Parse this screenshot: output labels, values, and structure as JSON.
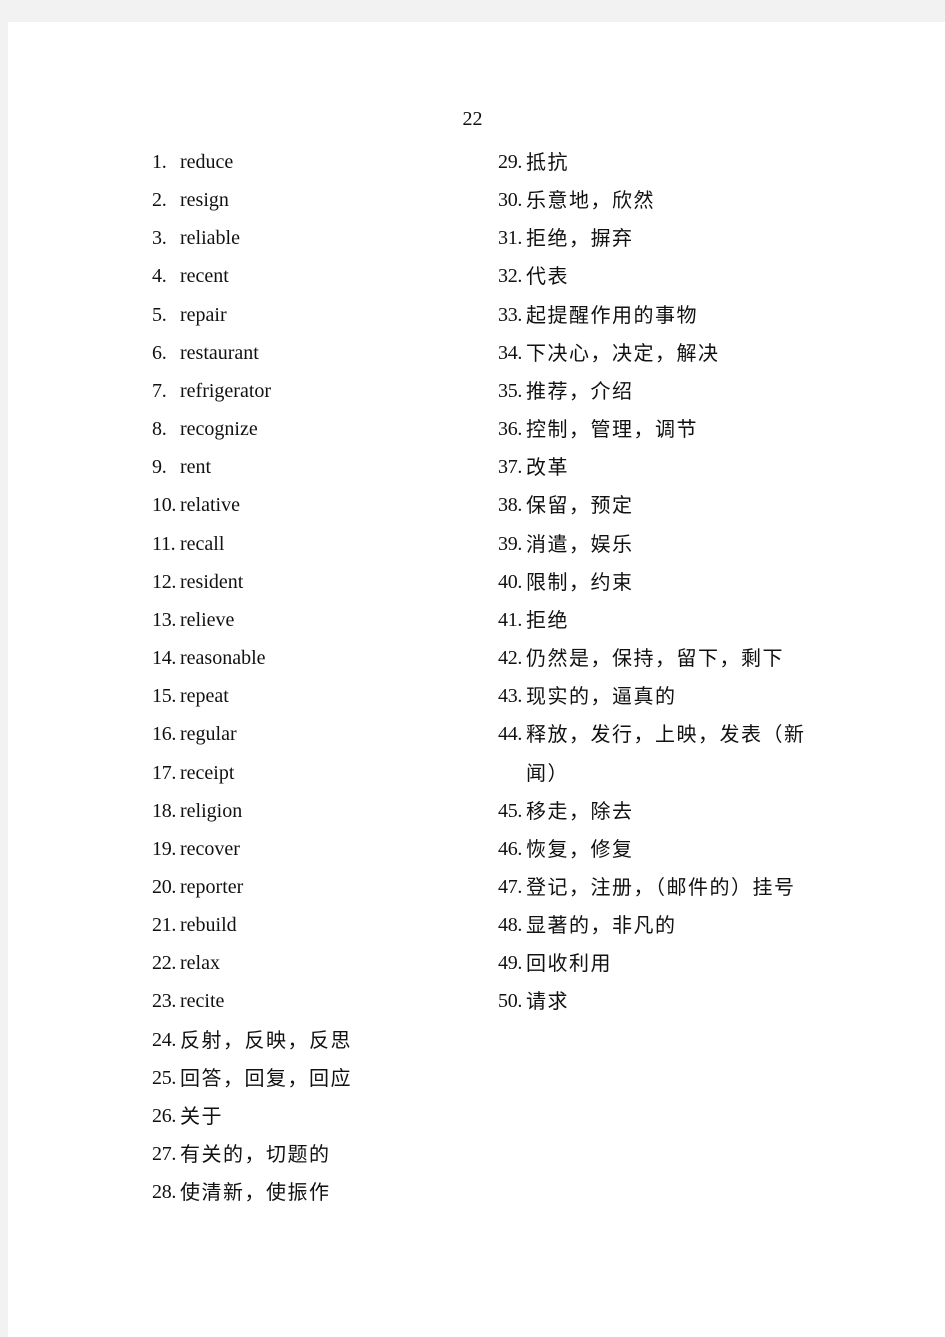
{
  "page_number": "22",
  "left_column": [
    {
      "num": "1.",
      "text": "reduce"
    },
    {
      "num": "2.",
      "text": "resign"
    },
    {
      "num": "3.",
      "text": "reliable"
    },
    {
      "num": "4.",
      "text": "recent"
    },
    {
      "num": "5.",
      "text": "repair"
    },
    {
      "num": "6.",
      "text": "restaurant"
    },
    {
      "num": "7.",
      "text": "refrigerator"
    },
    {
      "num": "8.",
      "text": "recognize"
    },
    {
      "num": "9.",
      "text": "rent"
    },
    {
      "num": "10.",
      "text": "relative"
    },
    {
      "num": "11.",
      "text": "recall"
    },
    {
      "num": "12.",
      "text": "resident"
    },
    {
      "num": "13.",
      "text": "relieve"
    },
    {
      "num": "14.",
      "text": "reasonable"
    },
    {
      "num": "15.",
      "text": "repeat"
    },
    {
      "num": "16.",
      "text": "regular"
    },
    {
      "num": "17.",
      "text": "receipt"
    },
    {
      "num": "18.",
      "text": "religion"
    },
    {
      "num": "19.",
      "text": "recover"
    },
    {
      "num": "20.",
      "text": "reporter"
    },
    {
      "num": "21.",
      "text": "rebuild"
    },
    {
      "num": "22.",
      "text": "relax"
    },
    {
      "num": "23.",
      "text": "recite"
    },
    {
      "num": "24.",
      "text": "反射，反映，反思"
    },
    {
      "num": "25.",
      "text": "回答，回复，回应"
    },
    {
      "num": "26.",
      "text": "关于"
    },
    {
      "num": "27.",
      "text": "有关的，切题的"
    },
    {
      "num": "28.",
      "text": "使清新，使振作"
    }
  ],
  "right_column": [
    {
      "num": "29.",
      "text": "抵抗"
    },
    {
      "num": "30.",
      "text": "乐意地，欣然"
    },
    {
      "num": "31.",
      "text": "拒绝，摒弃"
    },
    {
      "num": "32.",
      "text": "代表"
    },
    {
      "num": "33.",
      "text": "起提醒作用的事物"
    },
    {
      "num": "34.",
      "text": "下决心，决定，解决"
    },
    {
      "num": "35.",
      "text": "推荐，介绍"
    },
    {
      "num": "36.",
      "text": "控制，管理，调节"
    },
    {
      "num": "37.",
      "text": "改革"
    },
    {
      "num": "38.",
      "text": "保留，预定"
    },
    {
      "num": "39.",
      "text": "消遣，娱乐"
    },
    {
      "num": "40.",
      "text": "限制，约束"
    },
    {
      "num": "41.",
      "text": "拒绝"
    },
    {
      "num": "42.",
      "text": "仍然是，保持，留下，剩下"
    },
    {
      "num": "43.",
      "text": "现实的，逼真的"
    },
    {
      "num": "44.",
      "text": "释放，发行，上映，发表（新闻）"
    },
    {
      "num": "45.",
      "text": "移走，除去"
    },
    {
      "num": "46.",
      "text": "恢复，修复"
    },
    {
      "num": "47.",
      "text": "登记，注册，（邮件的）挂号"
    },
    {
      "num": "48.",
      "text": "显著的，非凡的"
    },
    {
      "num": "49.",
      "text": "回收利用"
    },
    {
      "num": "50.",
      "text": "请求"
    }
  ]
}
